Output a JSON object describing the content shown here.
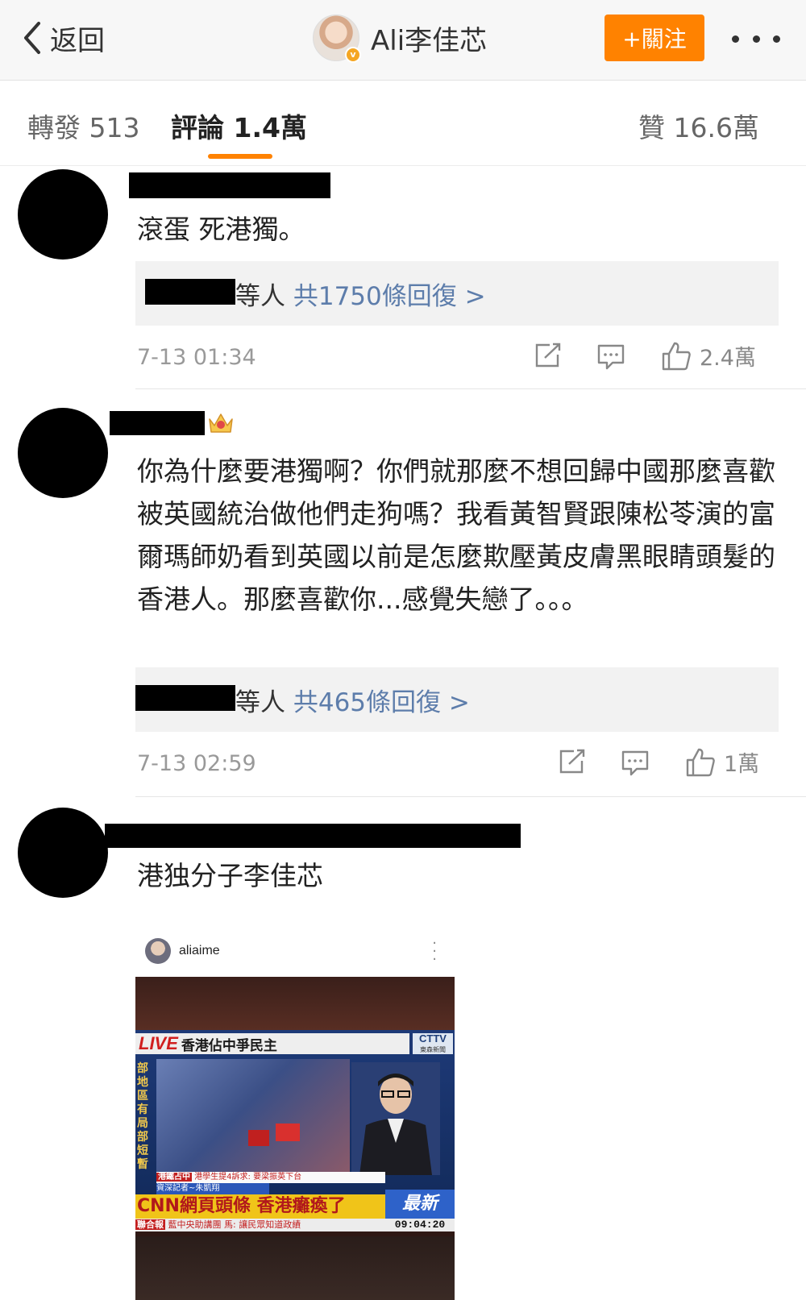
{
  "header": {
    "back_label": "返回",
    "user_name": "Ali李佳芯",
    "verified_badge": "v",
    "follow_label": "+關注",
    "more_icon": "more-dots-icon"
  },
  "tabs": [
    {
      "label": "轉發 513",
      "active": false
    },
    {
      "label": "評論 1.4萬",
      "active": true
    },
    {
      "label": "贊 16.6萬",
      "active": false
    }
  ],
  "accent_color": "#ff8200",
  "link_color": "#5d7dab",
  "comments": [
    {
      "text": "滾蛋 死港獨。",
      "reply_suffix": "等人",
      "reply_link": "共1750條回復 >",
      "time": "7-13 01:34",
      "likes": "2.4萬"
    },
    {
      "text": "你為什麼要港獨啊？你們就那麼不想回歸中國那麼喜歡被英國統治做他們走狗嗎？我看黃智賢跟陳松苓演的富爾瑪師奶看到英國以前是怎麼欺壓黃皮膚黑眼睛頭髮的香港人。那麼喜歡你...感覺失戀了。。。",
      "reply_suffix": "等人",
      "reply_link": "共465條回復 >",
      "time": "7-13 02:59",
      "likes": "1萬"
    },
    {
      "text": "港独分子李佳芯"
    }
  ],
  "embed": {
    "ig_user": "aliaime",
    "live": "LIVE",
    "live_title": "香港佔中爭民主",
    "channel": "CTTV",
    "channel_sub": "東森新聞",
    "vertical_text": "部地區有局部短暫",
    "ticker_tag": "港鐵占中",
    "ticker1": "港學生提4訴求: 要梁振英下台",
    "ticker2": "資深記者~朱凱翔",
    "headline": "CNN網頁頭條 香港癱瘓了",
    "newest": "最新",
    "ticker3_tag": "聯合報",
    "ticker3": "藍中央助講團 馬: 讓民眾知道政績",
    "clock": "09:04:20"
  }
}
